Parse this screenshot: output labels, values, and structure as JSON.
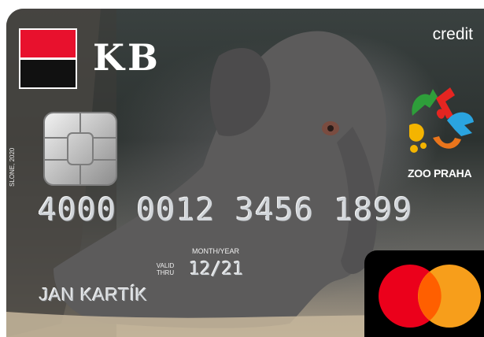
{
  "bank": {
    "name": "KB",
    "logo_colors": {
      "top": "#e8112d",
      "bottom": "#111111",
      "border": "#ffffff"
    }
  },
  "card_type": "credit",
  "partner": {
    "name": "ZOO PRAHA",
    "logo_colors": [
      "#2e9e3a",
      "#e52521",
      "#f4b400",
      "#2aa4e0",
      "#e9751c"
    ]
  },
  "card": {
    "number": "4000 0012 3456 1899",
    "valid_thru_label": "VALID THRU",
    "month_year_label": "MONTH/YEAR",
    "expiry": "12/21",
    "holder": "JAN KARTÍK"
  },
  "artist_credit": "SLONE, 2020",
  "network": {
    "name": "mastercard",
    "colors": {
      "left": "#eb001b",
      "right": "#f79e1b",
      "overlap": "#ff5f00"
    }
  },
  "icons": [
    "emv-chip-icon",
    "mastercard-logo-icon",
    "zoo-praha-logo-icon",
    "kb-logo-icon"
  ]
}
